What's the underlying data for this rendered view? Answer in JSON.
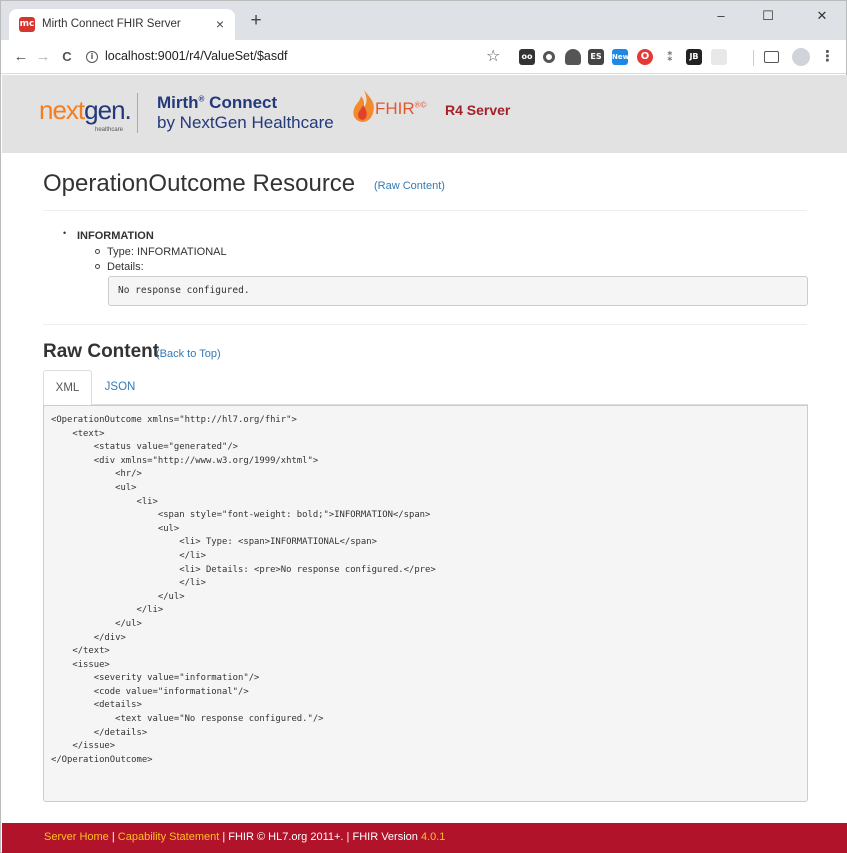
{
  "browser": {
    "tab_title": "Mirth Connect FHIR Server",
    "favicon_text": "mc",
    "tab_close": "×",
    "new_tab": "+",
    "url": "localhost:9001/r4/ValueSet/$asdf",
    "window_controls": {
      "minimize": "–",
      "maximize": "☐",
      "close": "✕"
    },
    "nav": {
      "back": "←",
      "forward": "→",
      "reload": "C",
      "info": "i"
    },
    "bookmark_star": "☆",
    "menu": "⋮",
    "extensions": [
      {
        "icon": "incognito-extension-icon",
        "color": "#333333",
        "label": "oo"
      },
      {
        "icon": "circle-extension-icon",
        "color": "#555555",
        "label": ""
      },
      {
        "icon": "drive-extension-icon",
        "color": "#555555",
        "label": ""
      },
      {
        "icon": "es-extension-icon",
        "color": "#444444",
        "label": "ES"
      },
      {
        "icon": "new-extension-icon",
        "color": "#1e88e5",
        "label": "New"
      },
      {
        "icon": "opera-extension-icon",
        "color": "#e53935",
        "label": "O"
      },
      {
        "icon": "dropbox-extension-icon",
        "color": "#777777",
        "label": ""
      },
      {
        "icon": "jb-extension-icon",
        "color": "#222222",
        "label": "JB"
      },
      {
        "icon": "blank-extension-icon",
        "color": "#dddddd",
        "label": ""
      },
      {
        "icon": "cast-extension-icon",
        "color": "#555555",
        "label": ""
      }
    ]
  },
  "header": {
    "logo_next": "next",
    "logo_gen": "gen.",
    "logo_sub": "healthcare",
    "product_line1": "Mirth",
    "product_line1_reg": "®",
    "product_line1_b": " Connect",
    "product_line2": "by NextGen Healthcare",
    "fhir_logo": "FHIR",
    "fhir_reg": "®©",
    "server_label": "R4 Server"
  },
  "resource": {
    "title": "OperationOutcome Resource",
    "raw_link_open": "(",
    "raw_link": "Raw Content",
    "raw_link_close": ")",
    "issue_bullet": "•",
    "issue_title": "INFORMATION",
    "type_item": "Type: INFORMATIONAL",
    "details_item": "Details:",
    "details_text": "No response configured."
  },
  "raw": {
    "title": "Raw Content",
    "back_link_open": "(",
    "back_link": "Back to Top",
    "back_link_close": ")",
    "tabs": [
      "XML",
      "JSON"
    ],
    "active_tab": "XML",
    "lines": [
      "<OperationOutcome xmlns=\"http://hl7.org/fhir\">",
      "    <text>",
      "        <status value=\"generated\"/>",
      "        <div xmlns=\"http://www.w3.org/1999/xhtml\">",
      "            <hr/>",
      "            <ul>",
      "                <li>",
      "                    <span style=\"font-weight: bold;\">INFORMATION</span>",
      "                    <ul>",
      "                        <li> Type: <span>INFORMATIONAL</span>",
      "                        </li>",
      "                        <li> Details: <pre>No response configured.</pre>",
      "                        </li>",
      "                    </ul>",
      "                </li>",
      "            </ul>",
      "        </div>",
      "    </text>",
      "    <issue>",
      "        <severity value=\"information\"/>",
      "        <code value=\"informational\"/>",
      "        <details>",
      "            <text value=\"No response configured.\"/>",
      "        </details>",
      "    </issue>",
      "</OperationOutcome>"
    ]
  },
  "footer": {
    "server_home": "Server Home",
    "capability": "Capability Statement",
    "separator": "|",
    "fhir_copyright": "FHIR © HL7.org 2011+.",
    "fhir_version_label": "FHIR Version",
    "fhir_version": "4.0.1"
  }
}
